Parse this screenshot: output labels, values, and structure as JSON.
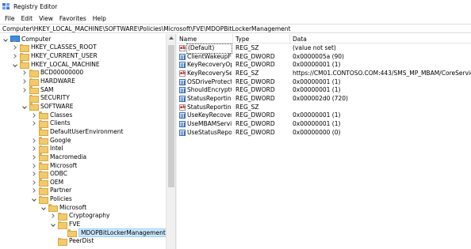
{
  "window": {
    "title": "Registry Editor"
  },
  "menu": [
    "File",
    "Edit",
    "View",
    "Favorites",
    "Help"
  ],
  "address": "Computer\\HKEY_LOCAL_MACHINE\\SOFTWARE\\Policies\\Microsoft\\FVE\\MDOPBitLockerManagement",
  "tree": [
    {
      "label": "Computer",
      "level": 0,
      "expander": "open",
      "icon": "computer"
    },
    {
      "label": "HKEY_CLASSES_ROOT",
      "level": 1,
      "expander": "closed",
      "icon": "folder"
    },
    {
      "label": "HKEY_CURRENT_USER",
      "level": 1,
      "expander": "closed",
      "icon": "folder"
    },
    {
      "label": "HKEY_LOCAL_MACHINE",
      "level": 1,
      "expander": "open",
      "icon": "folder"
    },
    {
      "label": "BCD00000000",
      "level": 2,
      "expander": "closed",
      "icon": "folder"
    },
    {
      "label": "HARDWARE",
      "level": 2,
      "expander": "closed",
      "icon": "folder"
    },
    {
      "label": "SAM",
      "level": 2,
      "expander": "closed",
      "icon": "folder"
    },
    {
      "label": "SECURITY",
      "level": 2,
      "expander": "",
      "icon": "folder"
    },
    {
      "label": "SOFTWARE",
      "level": 2,
      "expander": "open",
      "icon": "folder"
    },
    {
      "label": "Classes",
      "level": 3,
      "expander": "closed",
      "icon": "folder"
    },
    {
      "label": "Clients",
      "level": 3,
      "expander": "closed",
      "icon": "folder"
    },
    {
      "label": "DefaultUserEnvironment",
      "level": 3,
      "expander": "",
      "icon": "folder"
    },
    {
      "label": "Google",
      "level": 3,
      "expander": "closed",
      "icon": "folder"
    },
    {
      "label": "Intel",
      "level": 3,
      "expander": "closed",
      "icon": "folder"
    },
    {
      "label": "Macromedia",
      "level": 3,
      "expander": "closed",
      "icon": "folder"
    },
    {
      "label": "Microsoft",
      "level": 3,
      "expander": "closed",
      "icon": "folder"
    },
    {
      "label": "ODBC",
      "level": 3,
      "expander": "closed",
      "icon": "folder"
    },
    {
      "label": "OEM",
      "level": 3,
      "expander": "closed",
      "icon": "folder"
    },
    {
      "label": "Partner",
      "level": 3,
      "expander": "closed",
      "icon": "folder"
    },
    {
      "label": "Policies",
      "level": 3,
      "expander": "open",
      "icon": "folder"
    },
    {
      "label": "Microsoft",
      "level": 4,
      "expander": "open",
      "icon": "folder"
    },
    {
      "label": "Cryptography",
      "level": 5,
      "expander": "closed",
      "icon": "folder"
    },
    {
      "label": "FVE",
      "level": 5,
      "expander": "open",
      "icon": "folder"
    },
    {
      "label": "MDOPBitLockerManagement",
      "level": 6,
      "expander": "",
      "icon": "folder",
      "selected": true
    },
    {
      "label": "PeerDist",
      "level": 5,
      "expander": "",
      "icon": "folder"
    }
  ],
  "columns": {
    "name": "Name",
    "type": "Type",
    "data": "Data"
  },
  "values": [
    {
      "name": "(Default)",
      "type": "REG_SZ",
      "data": "(value not set)",
      "icon": "sz"
    },
    {
      "name": "ClientWakeupFr...",
      "type": "REG_DWORD",
      "data": "0x0000005a (90)",
      "icon": "dword"
    },
    {
      "name": "KeyRecoveryOpt...",
      "type": "REG_DWORD",
      "data": "0x00000001 (1)",
      "icon": "dword"
    },
    {
      "name": "KeyRecoverySer...",
      "type": "REG_SZ",
      "data": "https://CM01.CONTOSO.COM:443/SMS_MP_MBAM/CoreService.svc",
      "icon": "sz"
    },
    {
      "name": "OSDriveProtector",
      "type": "REG_DWORD",
      "data": "0x00000001 (1)",
      "icon": "dword"
    },
    {
      "name": "ShouldEncryptO...",
      "type": "REG_DWORD",
      "data": "0x00000001 (1)",
      "icon": "dword"
    },
    {
      "name": "StatusReporting...",
      "type": "REG_DWORD",
      "data": "0x000002d0 (720)",
      "icon": "dword"
    },
    {
      "name": "StatusReporting...",
      "type": "REG_SZ",
      "data": "",
      "icon": "sz"
    },
    {
      "name": "UseKeyRecovery...",
      "type": "REG_DWORD",
      "data": "0x00000001 (1)",
      "icon": "dword"
    },
    {
      "name": "UseMBAMServic...",
      "type": "REG_DWORD",
      "data": "0x00000001 (1)",
      "icon": "dword"
    },
    {
      "name": "UseStatusReport...",
      "type": "REG_DWORD",
      "data": "0x00000000 (0)",
      "icon": "dword"
    }
  ],
  "icon_text": {
    "sz": "ab"
  }
}
